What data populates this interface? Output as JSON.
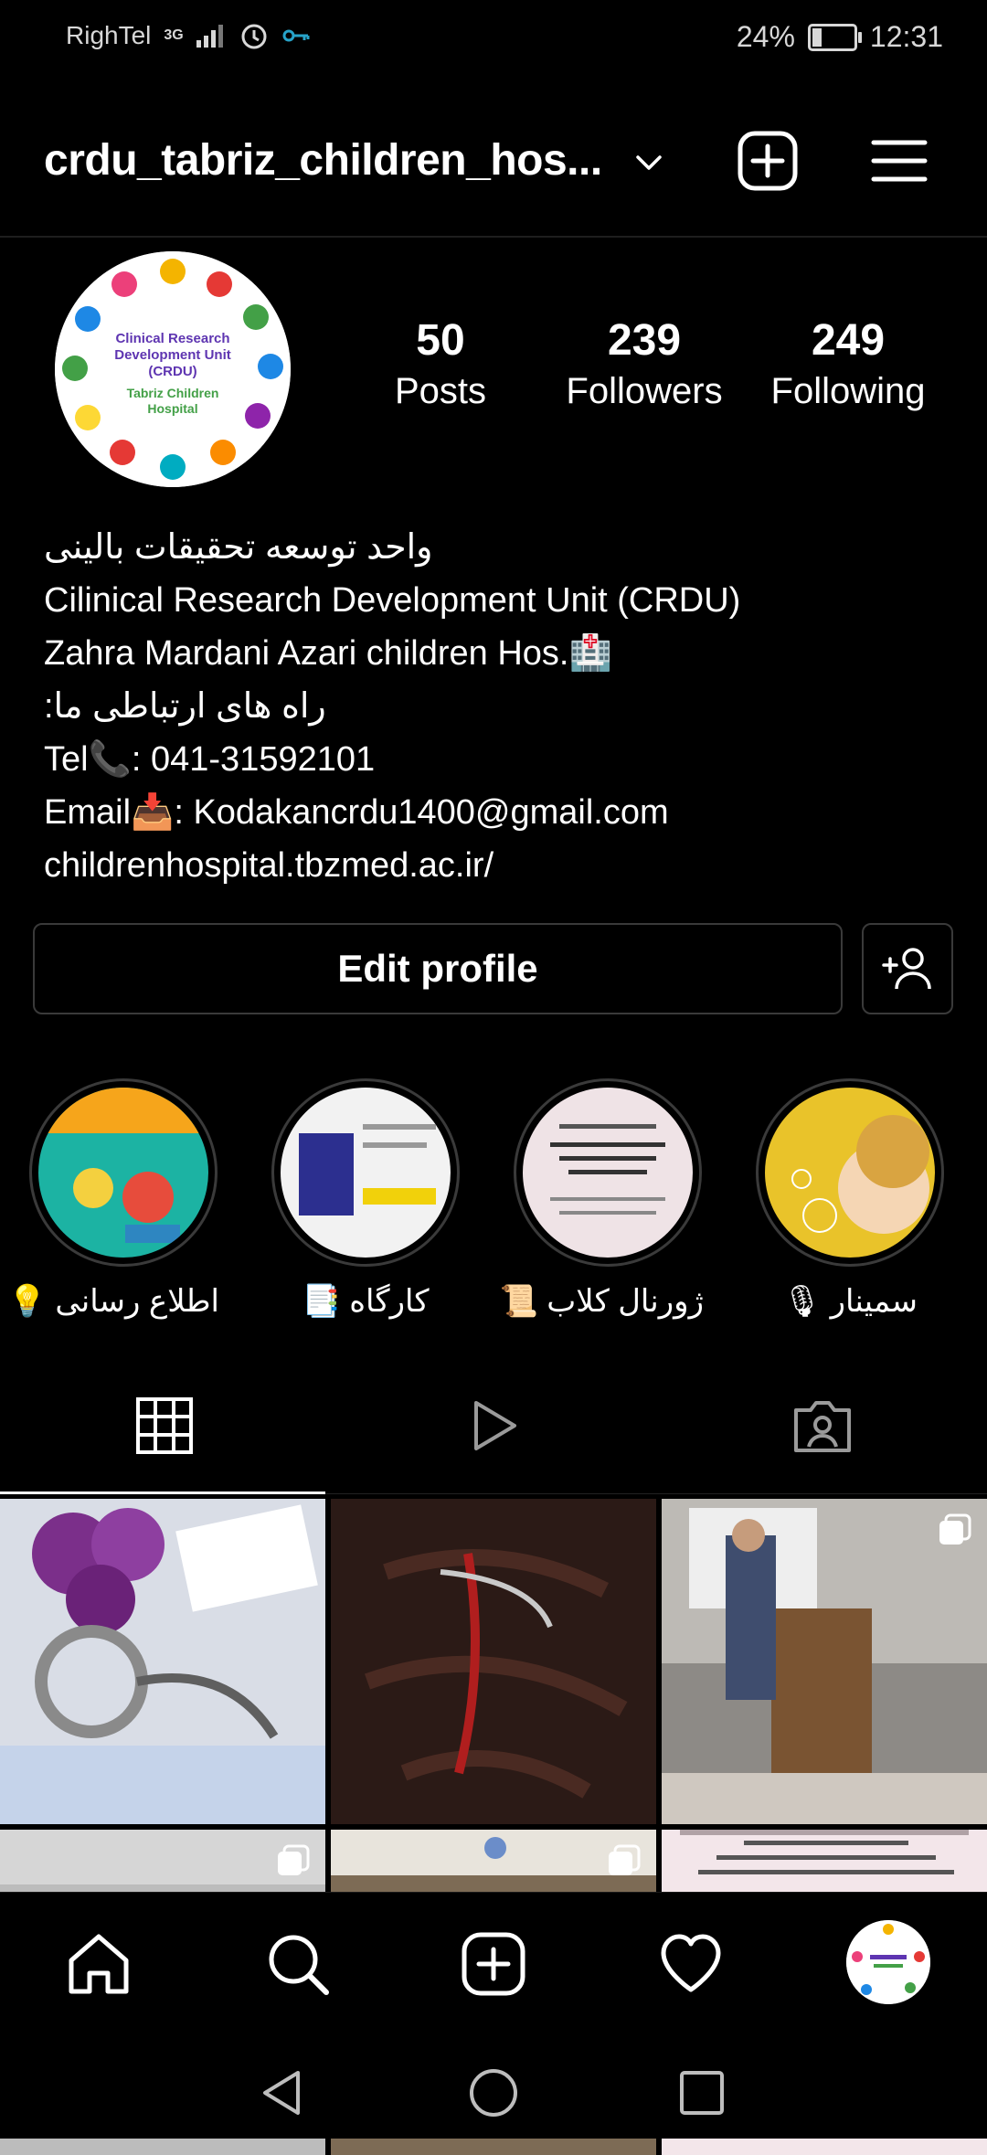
{
  "status_bar": {
    "carrier": "RighTel",
    "network": "3G",
    "battery": "24%",
    "battery_level": 0.24,
    "time": "12:31"
  },
  "header": {
    "username": "crdu_tabriz_children_hos..."
  },
  "profile": {
    "avatar_text": "Clinical Research Development Unit (CRDU) Tabriz Children Hospital",
    "avatar_text_lines": [
      "Clinical Research",
      "Development Unit",
      "(CRDU)",
      "Tabriz Children",
      "Hospital"
    ],
    "stats": [
      {
        "value": "50",
        "label": "Posts"
      },
      {
        "value": "239",
        "label": "Followers"
      },
      {
        "value": "249",
        "label": "Following"
      }
    ],
    "bio": [
      "واحد توسعه تحقیقات بالینی",
      "Cilinical Research Development Unit (CRDU)",
      "Zahra Mardani Azari children Hos.🏥",
      "راه های ارتباطی ما:",
      "Tel📞: 041-31592101",
      "Email📥: Kodakancrdu1400@gmail.com",
      "childrenhospital.tbzmed.ac.ir/"
    ],
    "edit_profile_label": "Edit profile"
  },
  "highlights": [
    {
      "label": "اطلاع رسانی 💡",
      "color": "#1cb3a3"
    },
    {
      "label": "کارگاه 📑",
      "color": "#f2f2f2"
    },
    {
      "label": "ژورنال کلاب 📜",
      "color": "#efe3e6"
    },
    {
      "label": "سمینار 🎙",
      "color": "#e9c32a"
    }
  ],
  "tabs": [
    {
      "name": "grid",
      "icon": "grid-icon",
      "active": true
    },
    {
      "name": "reels",
      "icon": "reels-play-icon",
      "active": false
    },
    {
      "name": "tagged",
      "icon": "tagged-person-icon",
      "active": false
    }
  ],
  "bottom_nav": [
    {
      "icon": "home-icon"
    },
    {
      "icon": "search-icon"
    },
    {
      "icon": "new-post-icon"
    },
    {
      "icon": "heart-icon"
    },
    {
      "icon": "profile-avatar-icon"
    }
  ],
  "colors": {
    "background": "#000000",
    "divider": "#3a3a3a",
    "text": "#ffffff"
  }
}
